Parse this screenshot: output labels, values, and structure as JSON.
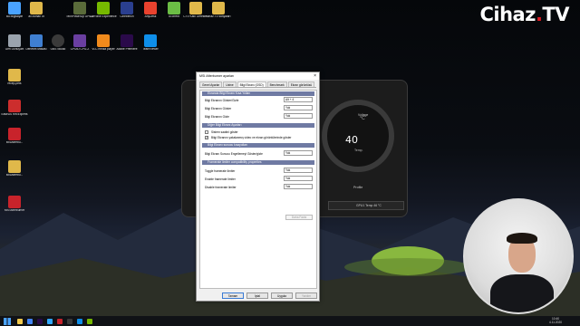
{
  "brand": {
    "name": "Cihaz",
    "dot": ".",
    "tld": "TV"
  },
  "desktop_icons": [
    {
      "label": "Bu bilgisayar",
      "color": "#4aa3ff"
    },
    {
      "label": "ali osman üt",
      "color": "#e0b84a"
    },
    {
      "label": "TechPowerUp GPU-Z",
      "color": "#5a6b3a"
    },
    {
      "label": "GeForce Experience",
      "color": "#76b900"
    },
    {
      "label": "Cinebench",
      "color": "#2a3f8f"
    },
    {
      "label": "AnyDesk",
      "color": "#e8422e"
    },
    {
      "label": "uTorrent",
      "color": "#6bbd45"
    },
    {
      "label": "CTV Katıl Gerekleri",
      "color": "#e0b84a"
    },
    {
      "label": "Cihaz.TV dosyaları",
      "color": "#e0b84a"
    },
    {
      "label": "Geri Dönüşüm",
      "color": "#9aa3ad"
    },
    {
      "label": "Denetim Masası",
      "color": "#3f7fd1"
    },
    {
      "label": "OBS Studio",
      "color": "#3a3a3a"
    },
    {
      "label": "CPUID CPU-Z",
      "color": "#6a3fa0"
    },
    {
      "label": "VLC media player",
      "color": "#f08a1c"
    },
    {
      "label": "Adobe Premiere",
      "color": "#2a0a4a"
    },
    {
      "label": "TeamViewer",
      "color": "#0e8ee9"
    },
    {
      "label": "recep-pets",
      "color": "#e0b84a"
    },
    {
      "label": "EaseUS RecExperts",
      "color": "#cc2d2d"
    },
    {
      "label": "MSIAfterbu...",
      "color": "#c8232b"
    },
    {
      "label": "MSIAfterbu...",
      "color": "#e0b84a"
    },
    {
      "label": "MSI Afterburner",
      "color": "#c8232b"
    }
  ],
  "widget": {
    "temp": "40",
    "deg_unit": "°C",
    "temp_label": "Temp.",
    "voltage_label": "Voltage",
    "profile_label": "Profile",
    "bar_text": "GPU1 Temp 46 °C"
  },
  "dialog": {
    "title": "MSI Afterburner ayarları",
    "tabs": [
      "Genel Ayarlar",
      "Ustne",
      "Bilgi Ekranı (OSD)",
      "Benchmark",
      "Ekran görüntüsü"
    ],
    "sections": {
      "s1": "Ekranda Bilgi Ekranı Kısa Yolları",
      "s2": "Diğer Bilgi Ekranı Ayarları",
      "s3": "Bilgi Ekranı sunucu kısayolları",
      "s4": "Framerate limiter compatibility properties"
    },
    "rows": {
      "osd_show_label": "Bilgi Ekranını Göster/Gizle",
      "osd_show_value": "Alt + 4",
      "osd_show2_label": "Bilgi Ekranını Göster",
      "osd_show2_value": "Yok",
      "osd_hide_label": "Bilgi Ekranını Gizle",
      "osd_hide_value": "Yok",
      "server_label": "Bilgi Ekranı Sunucu Engellemeyi Göster/gizle",
      "server_value": "Yok",
      "toggle_label": "Toggle framerate limiter",
      "toggle_value": "Yok",
      "enable_label": "Enable framerate limiter",
      "enable_value": "Yok",
      "disable_label": "Disable framerate limiter",
      "disable_value": "Yok",
      "more_button": "Daha Fazla"
    },
    "checks": {
      "c1": "Sistem saatini göster",
      "c2": "Bilgi Ekranını yakalanmış video ve ekran görüntülerinde göster"
    },
    "buttons": {
      "ok": "Tamam",
      "cancel": "İptal",
      "apply": "Uygula",
      "help": "Yardım"
    }
  },
  "taskbar": {
    "time": "10:40",
    "date": "4.11.2020"
  }
}
